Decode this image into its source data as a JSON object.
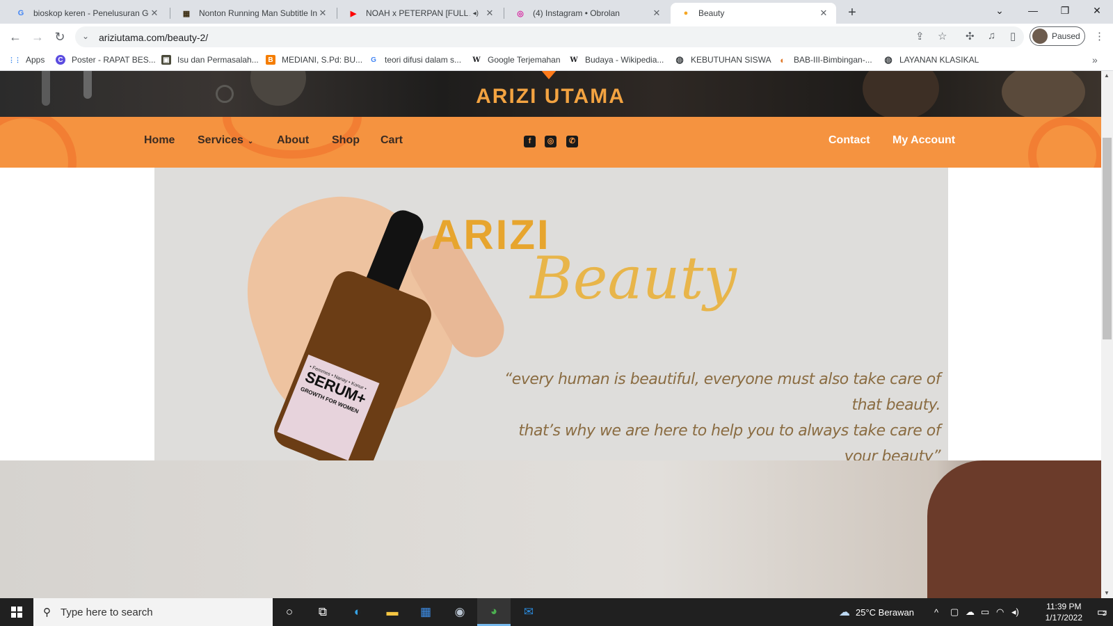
{
  "browser": {
    "tabs": [
      {
        "title": "bioskop keren - Penelusuran Goo",
        "icon": "google-icon",
        "favicon_text": "G",
        "favicon_color": "#4285f4",
        "active": false
      },
      {
        "title": "Nonton Running Man Subtitle In",
        "icon": "film-icon",
        "favicon_text": "▦",
        "favicon_color": "#3c2e12",
        "active": false
      },
      {
        "title": "NOAH x PETERPAN [FULL AL",
        "icon": "youtube-icon",
        "favicon_text": "▶",
        "favicon_color": "#ff0000",
        "active": false,
        "sound": "◂)"
      },
      {
        "title": "(4) Instagram • Obrolan",
        "icon": "instagram-icon",
        "favicon_text": "◎",
        "favicon_color": "#d6249f",
        "active": false
      },
      {
        "title": "Beauty",
        "icon": "flame-icon",
        "favicon_text": "●",
        "favicon_color": "#f5a623",
        "active": true
      }
    ],
    "tab_close": "✕",
    "new_tab": "+",
    "window_controls": {
      "dropdown": "⌄",
      "minimize": "—",
      "restore": "❐",
      "close": "✕"
    },
    "url": "ariziutama.com/beauty-2/",
    "profile_status": "Paused",
    "bookmarks": [
      {
        "label": "Apps",
        "icon": "apps-grid-icon",
        "glyph": "⋮⋮",
        "color": "#1a73e8"
      },
      {
        "label": "Poster - RAPAT BES...",
        "icon": "canva-icon",
        "glyph": "C",
        "color": "#5b4ce0"
      },
      {
        "label": "Isu dan Permasalah...",
        "icon": "book-icon",
        "glyph": "▣",
        "color": "#4a4a3a"
      },
      {
        "label": "MEDIANI, S.Pd: BU...",
        "icon": "blogger-icon",
        "glyph": "B",
        "color": "#f57d00"
      },
      {
        "label": "teori difusi dalam s...",
        "icon": "google-icon",
        "glyph": "G",
        "color": "#ffffff"
      },
      {
        "label": "Google Terjemahan",
        "icon": "wikipedia-icon",
        "glyph": "W",
        "color": "#ffffff"
      },
      {
        "label": "Budaya - Wikipedia...",
        "icon": "wikipedia-icon",
        "glyph": "W",
        "color": "#ffffff"
      },
      {
        "label": "KEBUTUHAN SISWA",
        "icon": "globe-icon",
        "glyph": "◍",
        "color": "#3c4043"
      },
      {
        "label": "BAB-III-Bimbingan-...",
        "icon": "doc-icon",
        "glyph": "◐",
        "color": "#e07a2c"
      },
      {
        "label": "LAYANAN KLASIKAL",
        "icon": "globe-icon",
        "glyph": "◍",
        "color": "#3c4043"
      }
    ],
    "bookmarks_more": "»"
  },
  "site": {
    "brand": "ARIZI UTAMA",
    "nav_left": [
      {
        "label": "Home"
      },
      {
        "label": "Services",
        "caret": "⌄"
      },
      {
        "label": "About"
      },
      {
        "label": "Shop"
      },
      {
        "label": "Cart"
      }
    ],
    "social": [
      {
        "icon": "facebook-icon",
        "glyph": "f"
      },
      {
        "icon": "instagram-icon",
        "glyph": "◎"
      },
      {
        "icon": "whatsapp-icon",
        "glyph": "✆"
      }
    ],
    "nav_right": [
      {
        "label": "Contact"
      },
      {
        "label": "My Account"
      }
    ],
    "banner": {
      "word1": "ARIZI",
      "word2": "Beauty",
      "quote_line1": "“every human is beautiful, everyone must also take care of that beauty.",
      "quote_line2": "that’s why we are here to help you to always take care of your beauty”",
      "product_small": "• Femmes • Nanay • Konur •",
      "product_name": "SERUM+",
      "product_sub": "GROWTH FOR WOMEN"
    },
    "colors": {
      "nav_bg": "#f59340",
      "brand": "#f3a341",
      "beauty_gold": "#e8b54a"
    }
  },
  "taskbar": {
    "search_placeholder": "Type here to search",
    "apps": [
      {
        "icon": "task-view-circle-icon",
        "glyph": "○"
      },
      {
        "icon": "task-view-icon",
        "glyph": "⧉"
      },
      {
        "icon": "edge-icon",
        "glyph": "◐"
      },
      {
        "icon": "file-explorer-icon",
        "glyph": "▬"
      },
      {
        "icon": "store-icon",
        "glyph": "▦"
      },
      {
        "icon": "camera-icon",
        "glyph": "◉"
      },
      {
        "icon": "chrome-icon",
        "glyph": "◕",
        "running": true
      },
      {
        "icon": "mail-icon",
        "glyph": "✉"
      }
    ],
    "weather": "25°C  Berawan",
    "time": "11:39 PM",
    "date": "1/17/2022",
    "notifications": "2"
  }
}
